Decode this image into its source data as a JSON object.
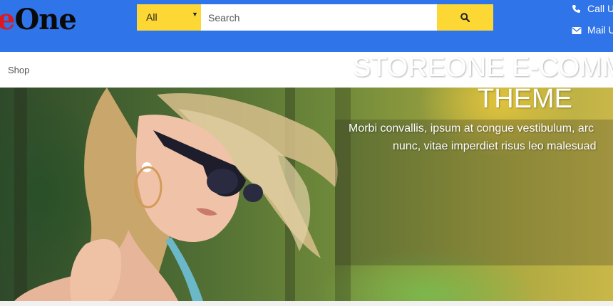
{
  "header": {
    "logo": {
      "accent_text": "e",
      "main_text": "One"
    },
    "search": {
      "category_selected": "All",
      "placeholder": "Search",
      "value": ""
    },
    "contact": {
      "call_label": "Call U",
      "mail_label": "Mail U"
    }
  },
  "breadcrumb": {
    "current": "Shop"
  },
  "hero": {
    "title_line1": "STOREONE E-COMM",
    "title_line2": "THEME",
    "subtitle_line1": "Morbi convallis, ipsum at congue vestibulum, arc",
    "subtitle_line2": "nunc, vitae imperdiet risus leo malesuad"
  },
  "colors": {
    "header_bg": "#2f74e8",
    "accent_yellow": "#fdd835",
    "logo_accent": "#e0191f"
  },
  "icons": [
    "chevron-down-icon",
    "search-icon",
    "phone-icon",
    "envelope-icon"
  ]
}
